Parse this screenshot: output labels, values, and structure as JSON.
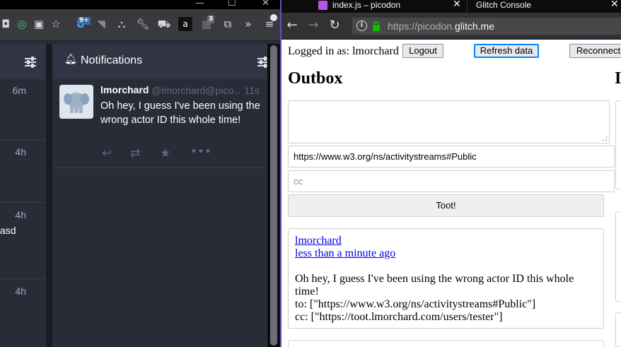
{
  "left_window": {
    "toolbar": {
      "badges": {
        "extension_count": "9+",
        "tab_count": "3"
      },
      "icons": [
        "pocket-icon",
        "circle-target-icon",
        "reader-icon",
        "bookmark-star-icon",
        "ublock-icon",
        "rss-icon",
        "sign-icon",
        "wrench-icon",
        "car-icon",
        "amazon-icon",
        "puzzle-icon",
        "screenshot-icon",
        "overflow-icon",
        "menu-icon"
      ]
    },
    "other_column": {
      "times": [
        "6m",
        "4h",
        "4h",
        "4h"
      ],
      "snippet": "asd"
    },
    "notifications": {
      "title": "Notifications",
      "status": {
        "display_name": "lmorchard",
        "handle": "@lmorchard@pico…",
        "time": "11s",
        "text": "Oh hey, I guess I've been using the wrong actor ID this whole time!"
      }
    }
  },
  "right_window": {
    "tabs": [
      {
        "label": "index.js – picodon"
      },
      {
        "label": "Glitch Console"
      }
    ],
    "url": {
      "prefix": "https://picodon.",
      "domain": "glitch.me"
    },
    "page": {
      "logged_in": "Logged in as: lmorchard",
      "logout": "Logout",
      "refresh": "Refresh data",
      "reconnect": "Reconnect",
      "outbox_heading": "Outbox",
      "inbox_heading_fragment": "I",
      "to_value": "https://www.w3.org/ns/activitystreams#Public",
      "cc_placeholder": "cc",
      "toot": "Toot!",
      "post": {
        "author": "lmorchard",
        "time": "less than a minute ago",
        "text": "Oh hey, I guess I've been using the wrong actor ID this whole time!",
        "to": "to: [\"https://www.w3.org/ns/activitystreams#Public\"]",
        "cc": "cc: [\"https://toot.lmorchard.com/users/tester\"]"
      }
    }
  },
  "colors": {
    "accent_focus": "#0a84ff",
    "link": "#0000ee",
    "mastodon_bg": "#282c37",
    "divider": "#6a4fbf"
  }
}
